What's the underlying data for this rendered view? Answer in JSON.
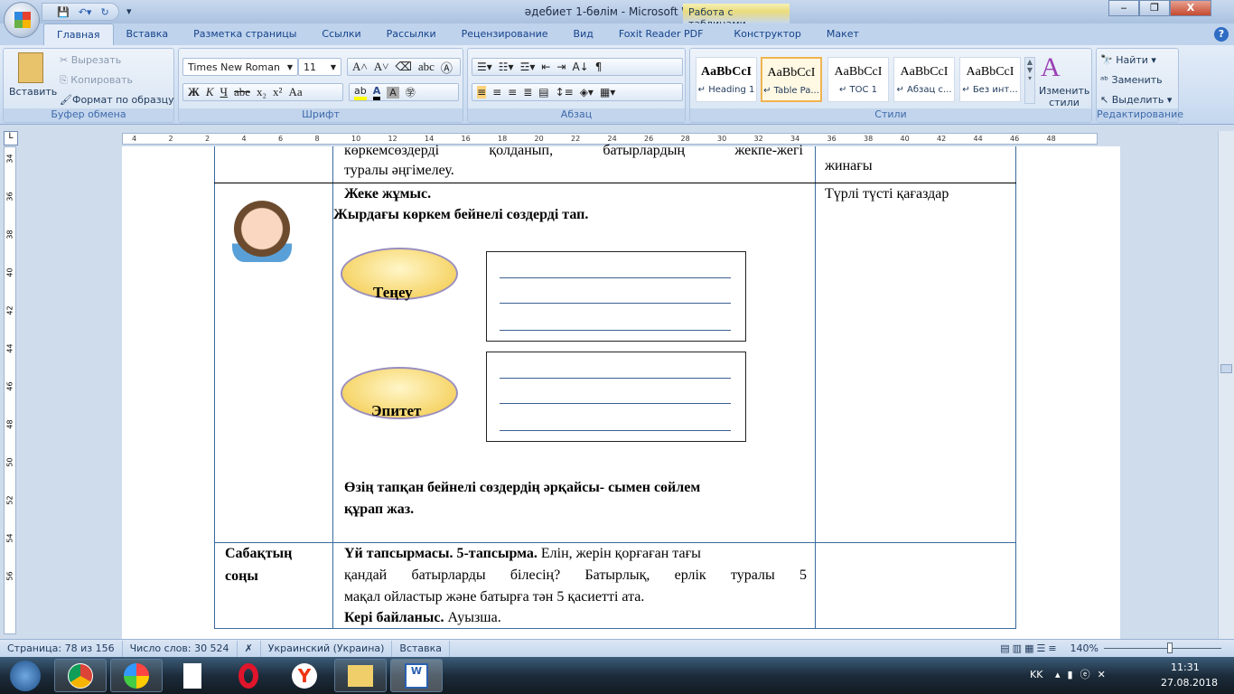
{
  "window": {
    "title": "әдебиет 1-бөлім - Microsoft Word",
    "context_tab": "Работа с таблицами",
    "minimize": "‒",
    "restore": "❐",
    "close": "X"
  },
  "tabs": [
    "Главная",
    "Вставка",
    "Разметка страницы",
    "Ссылки",
    "Рассылки",
    "Рецензирование",
    "Вид",
    "Foxit Reader PDF",
    "Конструктор",
    "Макет"
  ],
  "ribbon": {
    "clipboard": {
      "label": "Буфер обмена",
      "paste": "Вставить",
      "cut": "Вырезать",
      "copy": "Копировать",
      "format_painter": "Формат по образцу"
    },
    "font": {
      "label": "Шрифт",
      "font_name": "Times New Roman",
      "font_size": "11",
      "bold": "Ж",
      "italic": "К",
      "underline": "Ч",
      "strike": "abe",
      "sub": "x₂",
      "sup": "x²",
      "case": "Aa"
    },
    "paragraph": {
      "label": "Абзац"
    },
    "styles": {
      "label": "Стили",
      "items": [
        {
          "sample": "AaBbCcI",
          "name": "↵ Heading 1"
        },
        {
          "sample": "AaBbCcI",
          "name": "↵ Table Pa..."
        },
        {
          "sample": "AaBbCcI",
          "name": "↵ TOC 1"
        },
        {
          "sample": "AaBbCcI",
          "name": "↵ Абзац с..."
        },
        {
          "sample": "AaBbCcI",
          "name": "↵ Без инт..."
        }
      ],
      "change_styles": "Изменить стили"
    },
    "editing": {
      "label": "Редактирование",
      "find": "Найти",
      "replace": "Заменить",
      "select": "Выделить"
    }
  },
  "ruler": {
    "ticks": [
      "4",
      "2",
      "2",
      "4",
      "6",
      "8",
      "10",
      "12",
      "14",
      "16",
      "18",
      "20",
      "22",
      "24",
      "26",
      "28",
      "30",
      "32",
      "34",
      "36",
      "38",
      "40",
      "42",
      "44",
      "46",
      "48"
    ],
    "vticks": [
      "34",
      "36",
      "38",
      "40",
      "42",
      "44",
      "46",
      "48",
      "50",
      "52",
      "54",
      "56"
    ]
  },
  "document": {
    "row1": {
      "text_line1": "көркемсөздерді қолданып, батырлардың жекпе-жегі",
      "text_line2": "туралы әңгімелеу.",
      "right": "жинағы"
    },
    "row2": {
      "title": "Жеке жұмыс.",
      "task": "Жырдағы көркем бейнелі сөздерді тап.",
      "bubble1": "Теңеу",
      "bubble2": "Эпитет",
      "instruction_line1": "Өзің тапқан бейнелі сөздердің әрқайсы- сымен сөйлем",
      "instruction_line2": "құрап жаз.",
      "right": "Түрлі түсті қағаздар"
    },
    "row3": {
      "left_line1": "Сабақтың",
      "left_line2": "соңы",
      "hw_bold": "Үй тапсырмасы. 5-тапсырма.",
      "hw_text1": " Елін, жерін қорғаған тағы",
      "hw_text2": "қандай батырларды білесің? Батырлық, ерлік туралы 5",
      "hw_text3": "мақал ойластыр және батырға тән 5 қасиетті ата.",
      "fb_bold": "Кері байланыс.",
      "fb_text": " Ауызша."
    }
  },
  "status": {
    "page": "Страница: 78 из 156",
    "words": "Число слов: 30 524",
    "language": "Украинский (Украина)",
    "mode": "Вставка",
    "zoom": "140%",
    "zoom_level_percent": 140
  },
  "taskbar": {
    "apps": [
      "start",
      "chrome",
      "yandex-launcher",
      "document-viewer",
      "opera",
      "yandex-browser",
      "file-explorer",
      "microsoft-word"
    ],
    "lang": "KK",
    "time": "11:31",
    "date": "27.08.2018"
  }
}
